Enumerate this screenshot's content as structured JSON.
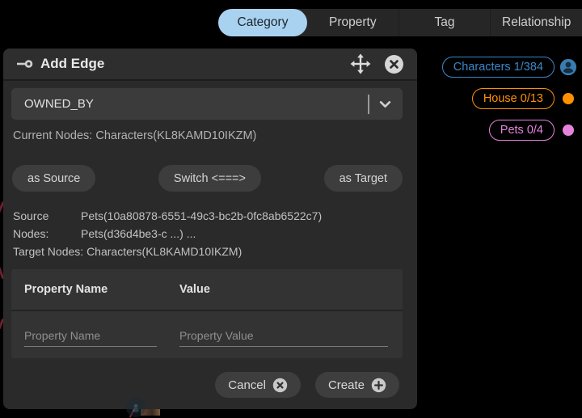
{
  "tabs": {
    "items": [
      {
        "label": "Category",
        "active": true
      },
      {
        "label": "Property",
        "active": false
      },
      {
        "label": "Tag",
        "active": false
      },
      {
        "label": "Relationship",
        "active": false
      }
    ]
  },
  "colors": {
    "active_tab_bg": "#a9d2f1",
    "active_tab_text": "#20262b",
    "characters_blue": "#3c86c9",
    "house_orange": "#ff9100",
    "pets_pink": "#e583dc"
  },
  "dialog": {
    "title": "Add Edge",
    "edge_type_value": "OWNED_BY",
    "current_nodes": "Current Nodes: Characters(KL8KAMD10IKZM)",
    "as_source_label": "as Source",
    "switch_label": "Switch <===>",
    "as_target_label": "as Target",
    "source_nodes_label": "Source Nodes:",
    "source_node_line1": "Pets(10a80878-6551-49c3-bc2b-0fc8ab6522c7)",
    "source_node_line2": "Pets(d36d4be3-c ...) ...",
    "target_nodes_label": "Target Nodes:",
    "target_nodes_value": "Characters(KL8KAMD10IKZM)",
    "property_table": {
      "name_header": "Property Name",
      "value_header": "Value",
      "name_placeholder": "Property Name",
      "value_placeholder": "Property Value"
    },
    "cancel_label": "Cancel",
    "create_label": "Create"
  },
  "legend": {
    "items": [
      {
        "label": "Characters 1/384",
        "color": "#3c86c9",
        "indicator": "user-icon"
      },
      {
        "label": "House 0/13",
        "color": "#ff9100",
        "indicator": "dot"
      },
      {
        "label": "Pets 0/4",
        "color": "#e583dc",
        "indicator": "dot"
      }
    ]
  }
}
